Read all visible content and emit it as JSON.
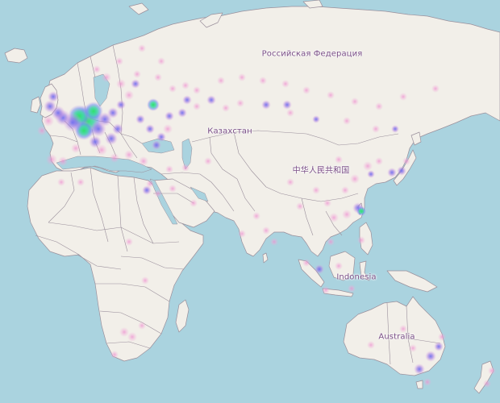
{
  "labels": {
    "russia": "Российская Федерация",
    "kazakhstan": "Казахстан",
    "china": "中华人民共和国",
    "indonesia": "Indonesia",
    "australia": "Australia"
  },
  "colors": {
    "water": "#aad3df",
    "land": "#f2efe9",
    "border": "#9a8f9b",
    "label": "#7a4e86",
    "heat_low": "#f3a6d8",
    "heat_mid": "#9a78e6",
    "heat_high": "#33d96a"
  }
}
